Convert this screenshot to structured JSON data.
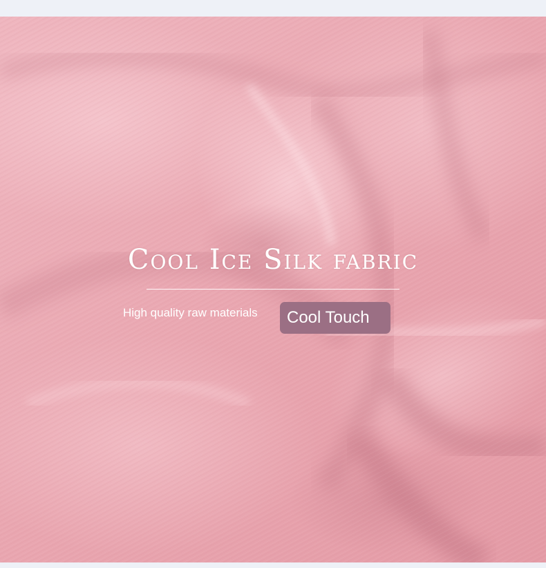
{
  "banner": {
    "title": "Cool Ice Silk fabric",
    "subtitle": "High quality raw materials",
    "badge_label": "Cool Touch"
  },
  "colors": {
    "fabric": "#eaa9b3",
    "badge": "#9b6f84",
    "text": "#ffffff",
    "background": "#eef1f7"
  }
}
